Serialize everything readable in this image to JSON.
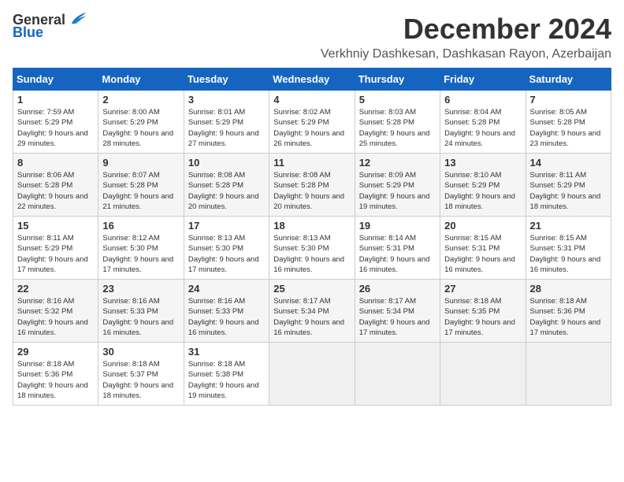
{
  "header": {
    "logo_general": "General",
    "logo_blue": "Blue",
    "title": "December 2024",
    "subtitle": "Verkhniy Dashkesan, Dashkasan Rayon, Azerbaijan"
  },
  "columns": [
    "Sunday",
    "Monday",
    "Tuesday",
    "Wednesday",
    "Thursday",
    "Friday",
    "Saturday"
  ],
  "weeks": [
    [
      {
        "day": "1",
        "sunrise": "Sunrise: 7:59 AM",
        "sunset": "Sunset: 5:29 PM",
        "daylight": "Daylight: 9 hours and 29 minutes."
      },
      {
        "day": "2",
        "sunrise": "Sunrise: 8:00 AM",
        "sunset": "Sunset: 5:29 PM",
        "daylight": "Daylight: 9 hours and 28 minutes."
      },
      {
        "day": "3",
        "sunrise": "Sunrise: 8:01 AM",
        "sunset": "Sunset: 5:29 PM",
        "daylight": "Daylight: 9 hours and 27 minutes."
      },
      {
        "day": "4",
        "sunrise": "Sunrise: 8:02 AM",
        "sunset": "Sunset: 5:29 PM",
        "daylight": "Daylight: 9 hours and 26 minutes."
      },
      {
        "day": "5",
        "sunrise": "Sunrise: 8:03 AM",
        "sunset": "Sunset: 5:28 PM",
        "daylight": "Daylight: 9 hours and 25 minutes."
      },
      {
        "day": "6",
        "sunrise": "Sunrise: 8:04 AM",
        "sunset": "Sunset: 5:28 PM",
        "daylight": "Daylight: 9 hours and 24 minutes."
      },
      {
        "day": "7",
        "sunrise": "Sunrise: 8:05 AM",
        "sunset": "Sunset: 5:28 PM",
        "daylight": "Daylight: 9 hours and 23 minutes."
      }
    ],
    [
      {
        "day": "8",
        "sunrise": "Sunrise: 8:06 AM",
        "sunset": "Sunset: 5:28 PM",
        "daylight": "Daylight: 9 hours and 22 minutes."
      },
      {
        "day": "9",
        "sunrise": "Sunrise: 8:07 AM",
        "sunset": "Sunset: 5:28 PM",
        "daylight": "Daylight: 9 hours and 21 minutes."
      },
      {
        "day": "10",
        "sunrise": "Sunrise: 8:08 AM",
        "sunset": "Sunset: 5:28 PM",
        "daylight": "Daylight: 9 hours and 20 minutes."
      },
      {
        "day": "11",
        "sunrise": "Sunrise: 8:08 AM",
        "sunset": "Sunset: 5:28 PM",
        "daylight": "Daylight: 9 hours and 20 minutes."
      },
      {
        "day": "12",
        "sunrise": "Sunrise: 8:09 AM",
        "sunset": "Sunset: 5:29 PM",
        "daylight": "Daylight: 9 hours and 19 minutes."
      },
      {
        "day": "13",
        "sunrise": "Sunrise: 8:10 AM",
        "sunset": "Sunset: 5:29 PM",
        "daylight": "Daylight: 9 hours and 18 minutes."
      },
      {
        "day": "14",
        "sunrise": "Sunrise: 8:11 AM",
        "sunset": "Sunset: 5:29 PM",
        "daylight": "Daylight: 9 hours and 18 minutes."
      }
    ],
    [
      {
        "day": "15",
        "sunrise": "Sunrise: 8:11 AM",
        "sunset": "Sunset: 5:29 PM",
        "daylight": "Daylight: 9 hours and 17 minutes."
      },
      {
        "day": "16",
        "sunrise": "Sunrise: 8:12 AM",
        "sunset": "Sunset: 5:30 PM",
        "daylight": "Daylight: 9 hours and 17 minutes."
      },
      {
        "day": "17",
        "sunrise": "Sunrise: 8:13 AM",
        "sunset": "Sunset: 5:30 PM",
        "daylight": "Daylight: 9 hours and 17 minutes."
      },
      {
        "day": "18",
        "sunrise": "Sunrise: 8:13 AM",
        "sunset": "Sunset: 5:30 PM",
        "daylight": "Daylight: 9 hours and 16 minutes."
      },
      {
        "day": "19",
        "sunrise": "Sunrise: 8:14 AM",
        "sunset": "Sunset: 5:31 PM",
        "daylight": "Daylight: 9 hours and 16 minutes."
      },
      {
        "day": "20",
        "sunrise": "Sunrise: 8:15 AM",
        "sunset": "Sunset: 5:31 PM",
        "daylight": "Daylight: 9 hours and 16 minutes."
      },
      {
        "day": "21",
        "sunrise": "Sunrise: 8:15 AM",
        "sunset": "Sunset: 5:31 PM",
        "daylight": "Daylight: 9 hours and 16 minutes."
      }
    ],
    [
      {
        "day": "22",
        "sunrise": "Sunrise: 8:16 AM",
        "sunset": "Sunset: 5:32 PM",
        "daylight": "Daylight: 9 hours and 16 minutes."
      },
      {
        "day": "23",
        "sunrise": "Sunrise: 8:16 AM",
        "sunset": "Sunset: 5:33 PM",
        "daylight": "Daylight: 9 hours and 16 minutes."
      },
      {
        "day": "24",
        "sunrise": "Sunrise: 8:16 AM",
        "sunset": "Sunset: 5:33 PM",
        "daylight": "Daylight: 9 hours and 16 minutes."
      },
      {
        "day": "25",
        "sunrise": "Sunrise: 8:17 AM",
        "sunset": "Sunset: 5:34 PM",
        "daylight": "Daylight: 9 hours and 16 minutes."
      },
      {
        "day": "26",
        "sunrise": "Sunrise: 8:17 AM",
        "sunset": "Sunset: 5:34 PM",
        "daylight": "Daylight: 9 hours and 17 minutes."
      },
      {
        "day": "27",
        "sunrise": "Sunrise: 8:18 AM",
        "sunset": "Sunset: 5:35 PM",
        "daylight": "Daylight: 9 hours and 17 minutes."
      },
      {
        "day": "28",
        "sunrise": "Sunrise: 8:18 AM",
        "sunset": "Sunset: 5:36 PM",
        "daylight": "Daylight: 9 hours and 17 minutes."
      }
    ],
    [
      {
        "day": "29",
        "sunrise": "Sunrise: 8:18 AM",
        "sunset": "Sunset: 5:36 PM",
        "daylight": "Daylight: 9 hours and 18 minutes."
      },
      {
        "day": "30",
        "sunrise": "Sunrise: 8:18 AM",
        "sunset": "Sunset: 5:37 PM",
        "daylight": "Daylight: 9 hours and 18 minutes."
      },
      {
        "day": "31",
        "sunrise": "Sunrise: 8:18 AM",
        "sunset": "Sunset: 5:38 PM",
        "daylight": "Daylight: 9 hours and 19 minutes."
      },
      null,
      null,
      null,
      null
    ]
  ]
}
